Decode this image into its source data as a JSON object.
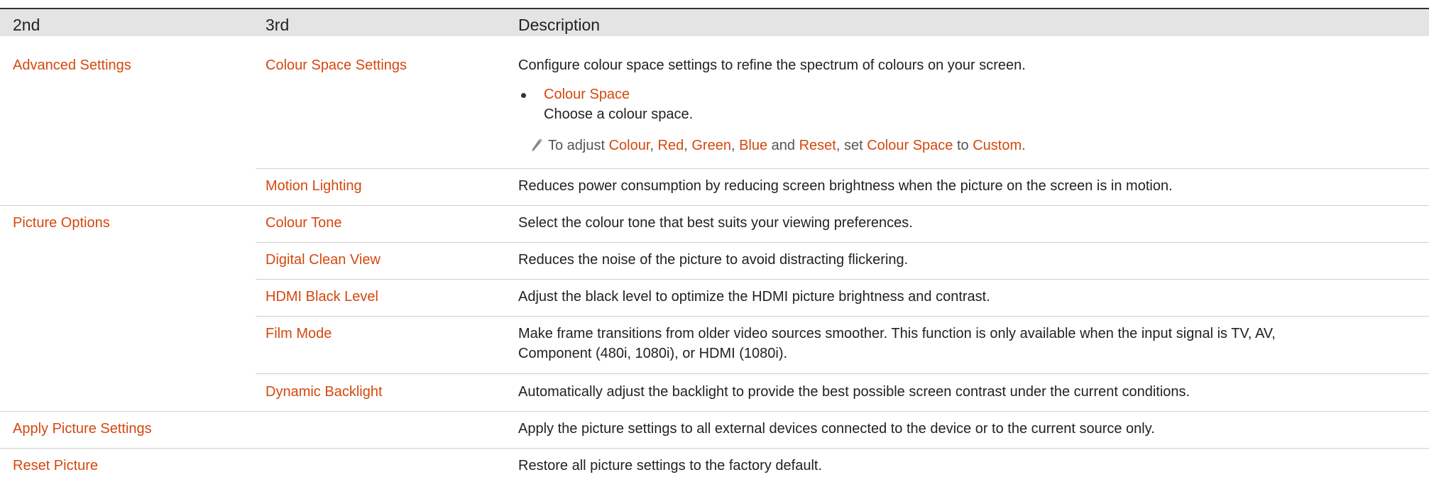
{
  "table": {
    "headers": {
      "col1": "2nd",
      "col2": "3rd",
      "col3": "Description"
    },
    "rows": [
      {
        "second": "Advanced Settings",
        "third": "Colour Space Settings",
        "description": "Configure colour space settings to refine the spectrum of colours on your screen.",
        "bullet": {
          "title": "Colour Space",
          "text": "Choose a colour space."
        },
        "note": {
          "icon": "pencil-icon",
          "prefix": "To adjust ",
          "colour": "Colour",
          "comma1": ", ",
          "red": "Red",
          "comma2": ", ",
          "green": "Green",
          "comma3": ", ",
          "blue": "Blue",
          "and": " and ",
          "reset": "Reset",
          "set": ", set ",
          "colour_space": "Colour Space",
          "to": " to ",
          "custom": "Custom",
          "period": "."
        }
      },
      {
        "second": "",
        "third": "Motion Lighting",
        "description": "Reduces power consumption by reducing screen brightness when the picture on the screen is in motion."
      },
      {
        "second": "Picture Options",
        "third": "Colour Tone",
        "description": "Select the colour tone that best suits your viewing preferences."
      },
      {
        "second": "",
        "third": "Digital Clean View",
        "description": "Reduces the noise of the picture to avoid distracting flickering."
      },
      {
        "second": "",
        "third": "HDMI Black Level",
        "description": "Adjust the black level to optimize the HDMI picture brightness and contrast."
      },
      {
        "second": "",
        "third": "Film Mode",
        "description_line1": "Make frame transitions from older video sources smoother. This function is only available when the input signal is TV, AV,",
        "description_line2": "Component (480i, 1080i), or HDMI (1080i)."
      },
      {
        "second": "",
        "third": "Dynamic Backlight",
        "description": "Automatically adjust the backlight to provide the best possible screen contrast under the current conditions."
      },
      {
        "second": "Apply Picture Settings",
        "third": "",
        "description": "Apply the picture settings to all external devices connected to the device or to the current source only."
      },
      {
        "second": "Reset Picture",
        "third": "",
        "description": "Restore all picture settings to the factory default."
      }
    ]
  },
  "colors": {
    "accent": "#d4480e",
    "header_bg": "#e4e4e4",
    "rule": "#cfcfcf"
  }
}
